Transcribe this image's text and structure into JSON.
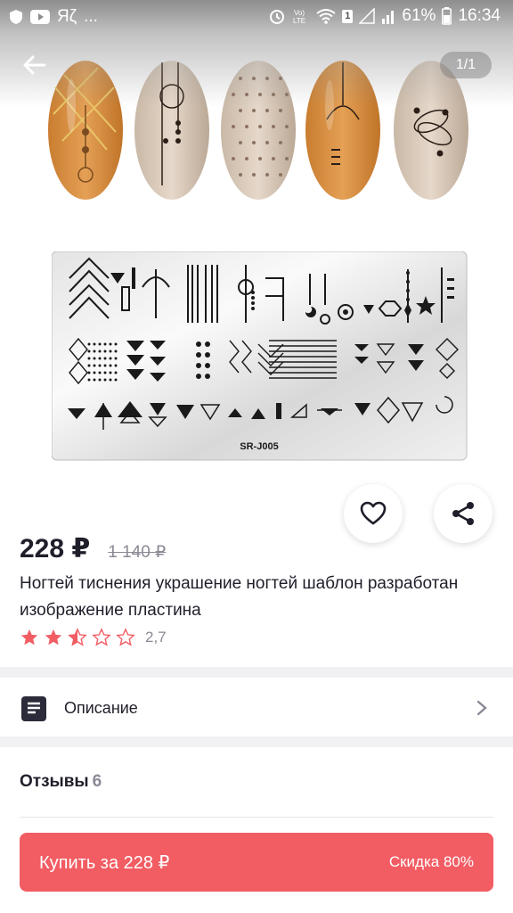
{
  "status_bar": {
    "left_icons": [
      "shield-icon",
      "youtube-icon",
      "yandex-icon",
      "more-icon"
    ],
    "yandex_text": "Яζ",
    "more_text": "...",
    "battery_percent": "61%",
    "time": "16:34",
    "sim_badge": "1"
  },
  "gallery": {
    "counter": "1/1",
    "plate_label": "SR-J005"
  },
  "product": {
    "price": "228 ₽",
    "old_price": "1 140 ₽",
    "title": "Ногтей тиснения украшение ногтей шаблон разработан изображение пластина",
    "rating_value": "2,7",
    "rating_stars": 2.5
  },
  "description": {
    "label": "Описание"
  },
  "reviews": {
    "label": "Отзывы",
    "count": "6"
  },
  "buy": {
    "label": "Купить за 228 ₽",
    "discount": "Скидка 80%"
  },
  "colors": {
    "accent": "#f25c63",
    "star": "#f25c63",
    "text": "#1f1f2b",
    "muted": "#8a8a96"
  }
}
